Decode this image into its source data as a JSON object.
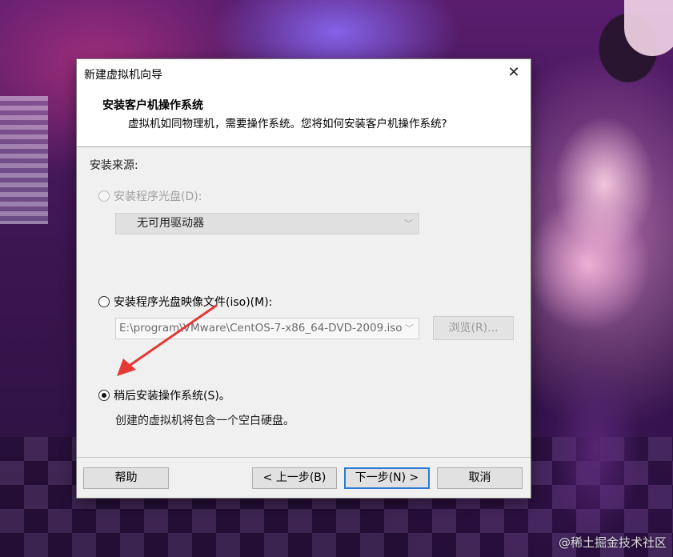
{
  "dialog": {
    "window_title": "新建虚拟机向导",
    "close_glyph": "✕",
    "heading": "安装客户机操作系统",
    "subheading": "虚拟机如同物理机，需要操作系统。您将如何安装客户机操作系统?"
  },
  "install_source": {
    "label": "安装来源:",
    "option_disc": {
      "label": "安装程序光盘(D):",
      "selected": false,
      "enabled": false,
      "dropdown_value": "无可用驱动器"
    },
    "option_iso": {
      "label": "安装程序光盘映像文件(iso)(M):",
      "selected": false,
      "enabled": true,
      "path_value": "E:\\program\\VMware\\CentOS-7-x86_64-DVD-2009.iso",
      "browse_label": "浏览(R)..."
    },
    "option_later": {
      "label": "稍后安装操作系统(S)。",
      "selected": true,
      "description": "创建的虚拟机将包含一个空白硬盘。"
    }
  },
  "footer": {
    "help_label": "帮助",
    "back_label": "< 上一步(B)",
    "next_label": "下一步(N) >",
    "cancel_label": "取消"
  },
  "annotation": {
    "arrow_color": "#e53935"
  },
  "watermark": "@稀土掘金技术社区"
}
